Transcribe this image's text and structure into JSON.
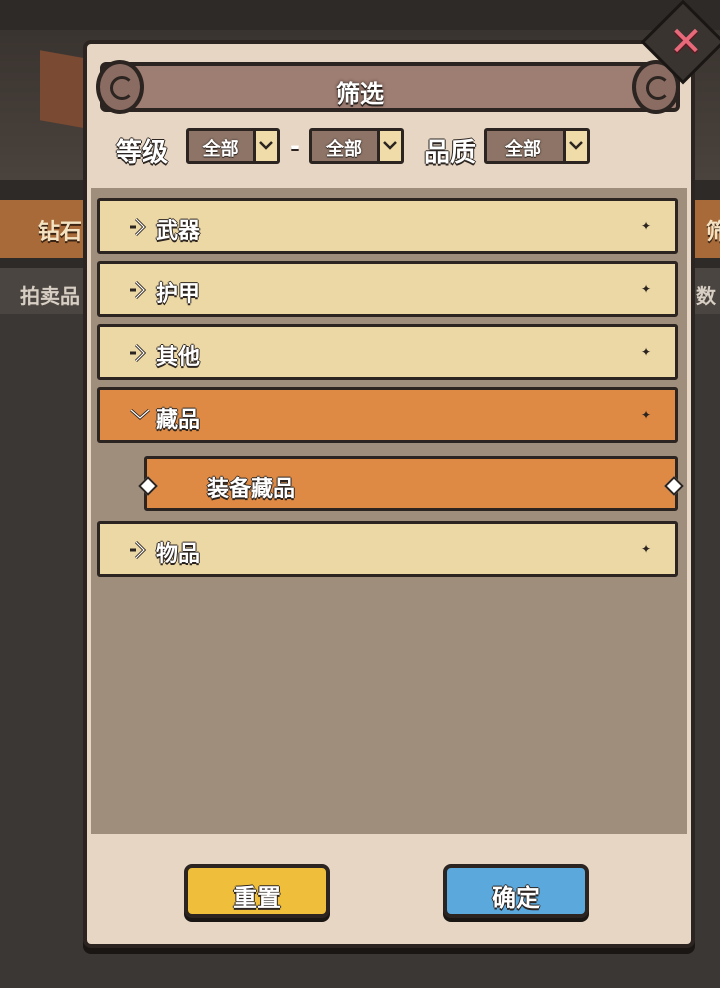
{
  "background": {
    "tab_left": "钻石",
    "tab_right": "筛",
    "row_left": "拍卖品",
    "row_right": "数量"
  },
  "modal": {
    "title": "筛选",
    "close_icon": "close-x-icon"
  },
  "filters": {
    "level_label": "等级",
    "level_min": "全部",
    "separator": "-",
    "level_max": "全部",
    "quality_label": "品质",
    "quality": "全部"
  },
  "categories": [
    {
      "label": "武器",
      "expanded": false
    },
    {
      "label": "护甲",
      "expanded": false
    },
    {
      "label": "其他",
      "expanded": false
    },
    {
      "label": "藏品",
      "expanded": true,
      "children": [
        {
          "label": "装备藏品",
          "selected": true
        }
      ]
    },
    {
      "label": "物品",
      "expanded": false
    }
  ],
  "buttons": {
    "reset": "重置",
    "confirm": "确定"
  },
  "colors": {
    "row_closed": "#ecd8a4",
    "row_open": "#de8a44",
    "reset_button": "#efbe3a",
    "confirm_button": "#5aa8dc",
    "close_icon": "#e86a7a"
  }
}
